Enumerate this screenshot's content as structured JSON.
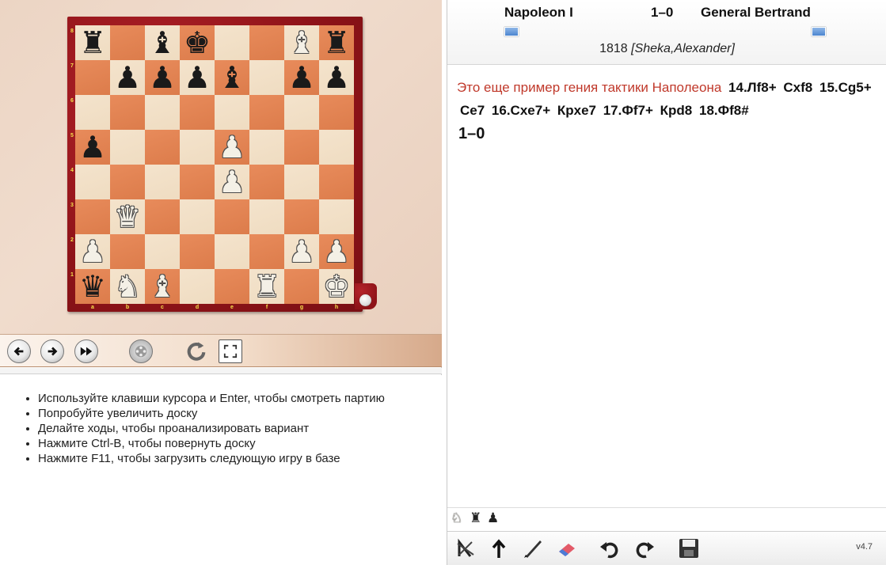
{
  "board": {
    "ranks": [
      "8",
      "7",
      "6",
      "5",
      "4",
      "3",
      "2",
      "1"
    ],
    "files": [
      "a",
      "b",
      "c",
      "d",
      "e",
      "f",
      "g",
      "h"
    ],
    "position": [
      [
        "bR",
        "",
        "bB",
        "bK",
        "",
        "",
        "wB",
        "bR"
      ],
      [
        "",
        "bP",
        "bP",
        "bP",
        "bB",
        "",
        "bP",
        "bP"
      ],
      [
        "",
        "",
        "",
        "",
        "",
        "",
        "",
        ""
      ],
      [
        "bP",
        "",
        "",
        "",
        "wP",
        "",
        "",
        ""
      ],
      [
        "",
        "",
        "",
        "",
        "wP",
        "",
        "",
        ""
      ],
      [
        "",
        "wQ",
        "",
        "",
        "",
        "",
        "",
        ""
      ],
      [
        "wP",
        "",
        "",
        "",
        "",
        "",
        "wP",
        "wP"
      ],
      [
        "bQ",
        "wN",
        "wB",
        "",
        "",
        "wR",
        "",
        "wK"
      ]
    ]
  },
  "nav_toolbar": {
    "back_icon": "arrow-left-icon",
    "forward_icon": "arrow-right-icon",
    "end_icon": "fast-forward-icon",
    "autoplay_icon": "film-reel-icon",
    "flip_icon": "rotate-icon",
    "fullscreen_icon": "expand-icon"
  },
  "hints": [
    "Используйте клавиши курсора и Enter, чтобы смотреть партию",
    "Попробуйте увеличить доску",
    "Делайте ходы, чтобы проанализировать вариант",
    "Нажмите Ctrl-B, чтобы повернуть доску",
    "Нажмите F11, чтобы загрузить следующую игру в базе"
  ],
  "game": {
    "white": "Napoleon I",
    "result": "1–0",
    "black": "General Bertrand",
    "year": "1818",
    "annotator": "[Sheka,Alexander]",
    "comment": "Это еще пример гения тактики Наполеона",
    "moves": [
      "14.Лf8+",
      "Cxf8",
      "15.Cg5+",
      "Ce7",
      "16.Cxe7+",
      "Крxe7",
      "17.Фf7+",
      "Крd8",
      "18.Фf8#"
    ],
    "final_result": "1–0"
  },
  "material_bar": [
    "♘",
    "♜",
    "♟"
  ],
  "edit_toolbar": {
    "icons": [
      "delete-variation-icon",
      "promote-variation-icon",
      "annotate-pen-icon",
      "eraser-icon",
      "undo-icon",
      "redo-icon",
      "save-icon"
    ],
    "version": "v4.7"
  },
  "colors": {
    "comment": "#c0392b",
    "frame": "#8e1318",
    "dark_square": "#e3854f",
    "light_square": "#f2e0c6"
  }
}
